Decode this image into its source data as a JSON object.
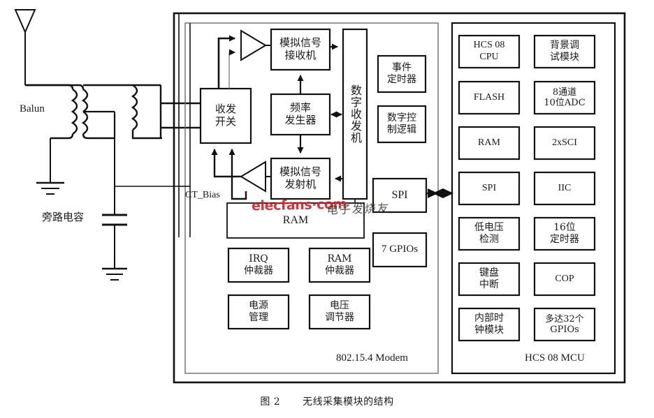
{
  "figure": {
    "caption_number": "图 2",
    "caption_title": "无线采集模块的结构"
  },
  "watermark": {
    "latin": "elecfans·com",
    "cjk": "电子发烧友",
    "latin_color": "#d2232a"
  },
  "rf_frontend": {
    "antenna_label": "",
    "balun_label": "Balun",
    "bypass_cap_label": "旁路电容",
    "ct_bias_label": "CT_Bias"
  },
  "modem": {
    "title": "802.15.4 Modem",
    "blocks": {
      "rx_switch": "收发\n开关",
      "analog_receiver": "模拟信号\n接收机",
      "freq_generator": "频率\n发生器",
      "analog_transmitter": "模拟信号\n发射机",
      "digital_transceiver": "数字收发机",
      "event_timer": "事件\n定时器",
      "digital_control_logic": "数字控\n制逻辑",
      "spi": "SPI",
      "gpios": "7 GPIOs",
      "ram": "RAM",
      "irq_arbiter": "IRQ\n仲裁器",
      "ram_arbiter": "RAM\n仲裁器",
      "power_management": "电源\n管理",
      "voltage_regulator": "电压\n调节器"
    }
  },
  "mcu": {
    "title": "HCS 08 MCU",
    "blocks_left": [
      "HCS 08\nCPU",
      "FLASH",
      "RAM",
      "SPI",
      "低电压\n检测",
      "键盘\n中断",
      "内部时\n钟模块"
    ],
    "blocks_right": [
      "背景调\n试模块",
      "8通道\n10位ADC",
      "2xSCI",
      "IIC",
      "16位\n定时器",
      "COP",
      "多达32个\nGPIOs"
    ]
  },
  "colors": {
    "line": "#111111",
    "box_border": "#111111",
    "background": "#ffffff",
    "thin_line": "#555555"
  }
}
